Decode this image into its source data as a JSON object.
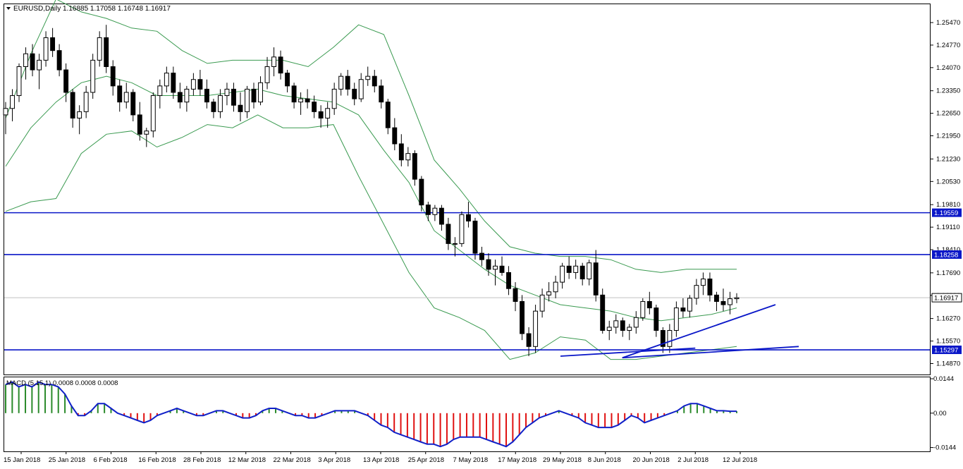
{
  "header": {
    "symbol": "EURUSD,Daily",
    "ohlc": "1.16885 1.17058 1.16748 1.16917",
    "dropdown_icon": "triangle-down-icon"
  },
  "chart_data": [
    {
      "type": "candlestick",
      "symbol": "EURUSD",
      "timeframe": "Daily",
      "last": {
        "open": 1.16885,
        "high": 1.17058,
        "low": 1.16748,
        "close": 1.16917
      },
      "ylim": [
        1.1453,
        1.2604
      ],
      "y_ticks": [
        "1.25470",
        "1.24770",
        "1.24070",
        "1.23350",
        "1.22650",
        "1.21950",
        "1.21230",
        "1.20530",
        "1.19810",
        "1.19110",
        "1.18410",
        "1.17690",
        "1.16990",
        "1.16270",
        "1.15570",
        "1.14870"
      ],
      "x_labels": [
        "15 Jan 2018",
        "25 Jan 2018",
        "6 Feb 2018",
        "16 Feb 2018",
        "28 Feb 2018",
        "12 Mar 2018",
        "22 Mar 2018",
        "3 Apr 2018",
        "13 Apr 2018",
        "25 Apr 2018",
        "7 May 2018",
        "17 May 2018",
        "29 May 2018",
        "8 Jun 2018",
        "20 Jun 2018",
        "2 Jul 2018",
        "12 Jul 2018"
      ],
      "horizontal_levels": [
        {
          "label": "1.19559",
          "value": 1.19559
        },
        {
          "label": "1.18258",
          "value": 1.18258
        },
        {
          "label": "1.15297",
          "value": 1.15297
        }
      ],
      "current_price": {
        "label": "1.16917",
        "value": 1.16917
      },
      "trendlines": [
        {
          "from": [
            "29 May 2018",
            1.151
          ],
          "to": [
            "2 Jul 2018",
            1.1535
          ]
        },
        {
          "from": [
            "18 Jun 2018",
            1.1505
          ],
          "to": [
            "13 Jul 2018",
            1.167
          ]
        },
        {
          "from": [
            "18 Jun 2018",
            1.1505
          ],
          "to": [
            "13 Jul 2018",
            1.154
          ]
        }
      ],
      "bollinger": {
        "middle": [
          1.21,
          1.222,
          1.23,
          1.236,
          1.238,
          1.236,
          1.232,
          1.232,
          1.232,
          1.233,
          1.234,
          1.232,
          1.231,
          1.23,
          1.226,
          1.215,
          1.205,
          1.19,
          1.184,
          1.178,
          1.173,
          1.17,
          1.167,
          1.166,
          1.165,
          1.163,
          1.162,
          1.163,
          1.164,
          1.166
        ],
        "upper": [
          1.225,
          1.245,
          1.262,
          1.258,
          1.256,
          1.253,
          1.252,
          1.246,
          1.242,
          1.243,
          1.243,
          1.243,
          1.241,
          1.247,
          1.254,
          1.251,
          1.232,
          1.212,
          1.203,
          1.193,
          1.185,
          1.183,
          1.182,
          1.182,
          1.181,
          1.178,
          1.177,
          1.178,
          1.178,
          1.178
        ],
        "lower": [
          1.196,
          1.199,
          1.2,
          1.214,
          1.22,
          1.221,
          1.216,
          1.219,
          1.223,
          1.222,
          1.226,
          1.222,
          1.222,
          1.223,
          1.207,
          1.192,
          1.177,
          1.166,
          1.163,
          1.159,
          1.15,
          1.152,
          1.157,
          1.156,
          1.15,
          1.15,
          1.151,
          1.152,
          1.153,
          1.154
        ]
      },
      "candles": [
        [
          1.226,
          1.23,
          1.22,
          1.228
        ],
        [
          1.228,
          1.234,
          1.224,
          1.232
        ],
        [
          1.232,
          1.242,
          1.23,
          1.241
        ],
        [
          1.241,
          1.247,
          1.237,
          1.245
        ],
        [
          1.245,
          1.248,
          1.238,
          1.24
        ],
        [
          1.24,
          1.245,
          1.234,
          1.243
        ],
        [
          1.243,
          1.252,
          1.241,
          1.25
        ],
        [
          1.25,
          1.253,
          1.244,
          1.246
        ],
        [
          1.246,
          1.248,
          1.238,
          1.24
        ],
        [
          1.24,
          1.242,
          1.23,
          1.233
        ],
        [
          1.233,
          1.234,
          1.222,
          1.225
        ],
        [
          1.225,
          1.229,
          1.22,
          1.227
        ],
        [
          1.227,
          1.235,
          1.225,
          1.233
        ],
        [
          1.233,
          1.245,
          1.231,
          1.243
        ],
        [
          1.243,
          1.252,
          1.241,
          1.25
        ],
        [
          1.25,
          1.254,
          1.239,
          1.241
        ],
        [
          1.241,
          1.243,
          1.232,
          1.235
        ],
        [
          1.235,
          1.237,
          1.227,
          1.23
        ],
        [
          1.23,
          1.236,
          1.228,
          1.233
        ],
        [
          1.233,
          1.234,
          1.224,
          1.226
        ],
        [
          1.226,
          1.23,
          1.218,
          1.22
        ],
        [
          1.22,
          1.222,
          1.216,
          1.221
        ],
        [
          1.221,
          1.233,
          1.219,
          1.232
        ],
        [
          1.232,
          1.237,
          1.228,
          1.235
        ],
        [
          1.235,
          1.241,
          1.233,
          1.239
        ],
        [
          1.239,
          1.241,
          1.231,
          1.233
        ],
        [
          1.233,
          1.236,
          1.228,
          1.23
        ],
        [
          1.23,
          1.235,
          1.227,
          1.234
        ],
        [
          1.234,
          1.239,
          1.232,
          1.237
        ],
        [
          1.237,
          1.24,
          1.232,
          1.234
        ],
        [
          1.234,
          1.237,
          1.228,
          1.23
        ],
        [
          1.23,
          1.231,
          1.225,
          1.227
        ],
        [
          1.227,
          1.234,
          1.225,
          1.232
        ],
        [
          1.232,
          1.236,
          1.229,
          1.234
        ],
        [
          1.234,
          1.236,
          1.227,
          1.229
        ],
        [
          1.229,
          1.233,
          1.224,
          1.227
        ],
        [
          1.227,
          1.235,
          1.225,
          1.234
        ],
        [
          1.234,
          1.236,
          1.228,
          1.23
        ],
        [
          1.23,
          1.238,
          1.229,
          1.236
        ],
        [
          1.236,
          1.244,
          1.234,
          1.241
        ],
        [
          1.241,
          1.247,
          1.238,
          1.244
        ],
        [
          1.244,
          1.246,
          1.237,
          1.239
        ],
        [
          1.239,
          1.24,
          1.233,
          1.235
        ],
        [
          1.235,
          1.236,
          1.228,
          1.23
        ],
        [
          1.23,
          1.233,
          1.226,
          1.231
        ],
        [
          1.231,
          1.234,
          1.228,
          1.23
        ],
        [
          1.23,
          1.232,
          1.225,
          1.227
        ],
        [
          1.227,
          1.229,
          1.222,
          1.225
        ],
        [
          1.225,
          1.23,
          1.222,
          1.228
        ],
        [
          1.228,
          1.236,
          1.226,
          1.234
        ],
        [
          1.234,
          1.239,
          1.232,
          1.238
        ],
        [
          1.238,
          1.24,
          1.232,
          1.234
        ],
        [
          1.234,
          1.236,
          1.229,
          1.231
        ],
        [
          1.231,
          1.239,
          1.23,
          1.237
        ],
        [
          1.237,
          1.241,
          1.235,
          1.238
        ],
        [
          1.238,
          1.24,
          1.233,
          1.235
        ],
        [
          1.235,
          1.237,
          1.228,
          1.23
        ],
        [
          1.23,
          1.231,
          1.22,
          1.222
        ],
        [
          1.222,
          1.225,
          1.215,
          1.217
        ],
        [
          1.217,
          1.22,
          1.21,
          1.212
        ],
        [
          1.212,
          1.216,
          1.21,
          1.214
        ],
        [
          1.214,
          1.215,
          1.204,
          1.206
        ],
        [
          1.206,
          1.207,
          1.196,
          1.198
        ],
        [
          1.198,
          1.199,
          1.193,
          1.195
        ],
        [
          1.195,
          1.198,
          1.193,
          1.197
        ],
        [
          1.197,
          1.198,
          1.19,
          1.192
        ],
        [
          1.192,
          1.194,
          1.184,
          1.186
        ],
        [
          1.186,
          1.188,
          1.182,
          1.186
        ],
        [
          1.186,
          1.196,
          1.185,
          1.195
        ],
        [
          1.195,
          1.199,
          1.191,
          1.193
        ],
        [
          1.193,
          1.194,
          1.181,
          1.183
        ],
        [
          1.183,
          1.185,
          1.179,
          1.181
        ],
        [
          1.181,
          1.183,
          1.176,
          1.178
        ],
        [
          1.178,
          1.181,
          1.173,
          1.179
        ],
        [
          1.179,
          1.182,
          1.176,
          1.177
        ],
        [
          1.177,
          1.179,
          1.17,
          1.172
        ],
        [
          1.172,
          1.174,
          1.165,
          1.168
        ],
        [
          1.168,
          1.17,
          1.156,
          1.158
        ],
        [
          1.158,
          1.16,
          1.151,
          1.154
        ],
        [
          1.154,
          1.167,
          1.152,
          1.165
        ],
        [
          1.165,
          1.172,
          1.163,
          1.17
        ],
        [
          1.17,
          1.174,
          1.168,
          1.171
        ],
        [
          1.171,
          1.176,
          1.169,
          1.174
        ],
        [
          1.174,
          1.18,
          1.172,
          1.179
        ],
        [
          1.179,
          1.182,
          1.175,
          1.177
        ],
        [
          1.177,
          1.181,
          1.175,
          1.179
        ],
        [
          1.179,
          1.18,
          1.173,
          1.175
        ],
        [
          1.175,
          1.181,
          1.173,
          1.18
        ],
        [
          1.18,
          1.184,
          1.168,
          1.17
        ],
        [
          1.17,
          1.172,
          1.158,
          1.159
        ],
        [
          1.159,
          1.162,
          1.156,
          1.16
        ],
        [
          1.16,
          1.164,
          1.158,
          1.162
        ],
        [
          1.162,
          1.163,
          1.157,
          1.159
        ],
        [
          1.159,
          1.161,
          1.156,
          1.16
        ],
        [
          1.16,
          1.165,
          1.158,
          1.163
        ],
        [
          1.163,
          1.169,
          1.162,
          1.168
        ],
        [
          1.168,
          1.171,
          1.164,
          1.166
        ],
        [
          1.166,
          1.167,
          1.157,
          1.159
        ],
        [
          1.159,
          1.16,
          1.152,
          1.154
        ],
        [
          1.154,
          1.161,
          1.152,
          1.159
        ],
        [
          1.159,
          1.168,
          1.157,
          1.166
        ],
        [
          1.166,
          1.169,
          1.163,
          1.165
        ],
        [
          1.165,
          1.17,
          1.163,
          1.169
        ],
        [
          1.169,
          1.175,
          1.167,
          1.173
        ],
        [
          1.173,
          1.177,
          1.17,
          1.175
        ],
        [
          1.175,
          1.177,
          1.168,
          1.17
        ],
        [
          1.17,
          1.171,
          1.165,
          1.168
        ],
        [
          1.168,
          1.172,
          1.165,
          1.167
        ],
        [
          1.167,
          1.171,
          1.164,
          1.16885
        ],
        [
          1.16885,
          1.17058,
          1.16748,
          1.16917
        ]
      ]
    },
    {
      "type": "histogram-line",
      "indicator": "MACD",
      "label": "MACD (5,15,1) 0.0008 0.0008 0.0008",
      "y_ticks": [
        "0.0144",
        "0.00",
        "-0.0144"
      ],
      "ylim": [
        -0.016,
        0.015
      ],
      "colors": {
        "up": "#2a8a2a",
        "down": "#e01010",
        "signal": "#1020c8"
      },
      "histogram": [
        0.012,
        0.013,
        0.011,
        0.012,
        0.011,
        0.013,
        0.012,
        0.012,
        0.011,
        0.008,
        0.003,
        -0.001,
        -0.001,
        0.001,
        0.004,
        0.004,
        0.002,
        0.0,
        -0.001,
        -0.002,
        -0.003,
        -0.004,
        -0.003,
        -0.001,
        0.0,
        0.001,
        0.002,
        0.001,
        0.0,
        -0.001,
        -0.001,
        0.0,
        0.001,
        0.001,
        0.0,
        -0.001,
        -0.002,
        -0.002,
        -0.001,
        0.001,
        0.002,
        0.002,
        0.001,
        0.0,
        -0.001,
        -0.001,
        -0.002,
        -0.002,
        -0.001,
        0.0,
        0.001,
        0.001,
        0.001,
        0.001,
        0.0,
        -0.001,
        -0.003,
        -0.005,
        -0.006,
        -0.008,
        -0.009,
        -0.01,
        -0.011,
        -0.012,
        -0.013,
        -0.013,
        -0.014,
        -0.013,
        -0.011,
        -0.01,
        -0.01,
        -0.01,
        -0.01,
        -0.011,
        -0.012,
        -0.013,
        -0.014,
        -0.012,
        -0.009,
        -0.006,
        -0.004,
        -0.002,
        -0.001,
        0.0,
        0.001,
        0.0,
        -0.001,
        -0.002,
        -0.004,
        -0.005,
        -0.006,
        -0.006,
        -0.006,
        -0.005,
        -0.003,
        -0.001,
        -0.002,
        -0.004,
        -0.003,
        -0.002,
        -0.001,
        0.0,
        0.001,
        0.003,
        0.004,
        0.004,
        0.003,
        0.002,
        0.001,
        0.001,
        0.0008,
        0.0008
      ],
      "signal": [
        0.012,
        0.013,
        0.011,
        0.012,
        0.011,
        0.013,
        0.012,
        0.012,
        0.011,
        0.008,
        0.003,
        -0.001,
        -0.001,
        0.001,
        0.004,
        0.004,
        0.002,
        0.0,
        -0.001,
        -0.002,
        -0.003,
        -0.004,
        -0.003,
        -0.001,
        0.0,
        0.001,
        0.002,
        0.001,
        0.0,
        -0.001,
        -0.001,
        0.0,
        0.001,
        0.001,
        0.0,
        -0.001,
        -0.002,
        -0.002,
        -0.001,
        0.001,
        0.002,
        0.002,
        0.001,
        0.0,
        -0.001,
        -0.001,
        -0.002,
        -0.002,
        -0.001,
        0.0,
        0.001,
        0.001,
        0.001,
        0.001,
        0.0,
        -0.001,
        -0.003,
        -0.005,
        -0.006,
        -0.008,
        -0.009,
        -0.01,
        -0.011,
        -0.012,
        -0.013,
        -0.013,
        -0.014,
        -0.013,
        -0.011,
        -0.01,
        -0.01,
        -0.01,
        -0.01,
        -0.011,
        -0.012,
        -0.013,
        -0.014,
        -0.012,
        -0.009,
        -0.006,
        -0.004,
        -0.002,
        -0.001,
        0.0,
        0.001,
        0.0,
        -0.001,
        -0.002,
        -0.004,
        -0.005,
        -0.006,
        -0.006,
        -0.006,
        -0.005,
        -0.003,
        -0.001,
        -0.002,
        -0.004,
        -0.003,
        -0.002,
        -0.001,
        0.0,
        0.001,
        0.003,
        0.004,
        0.004,
        0.003,
        0.002,
        0.001,
        0.001,
        0.0008,
        0.0008
      ]
    }
  ]
}
